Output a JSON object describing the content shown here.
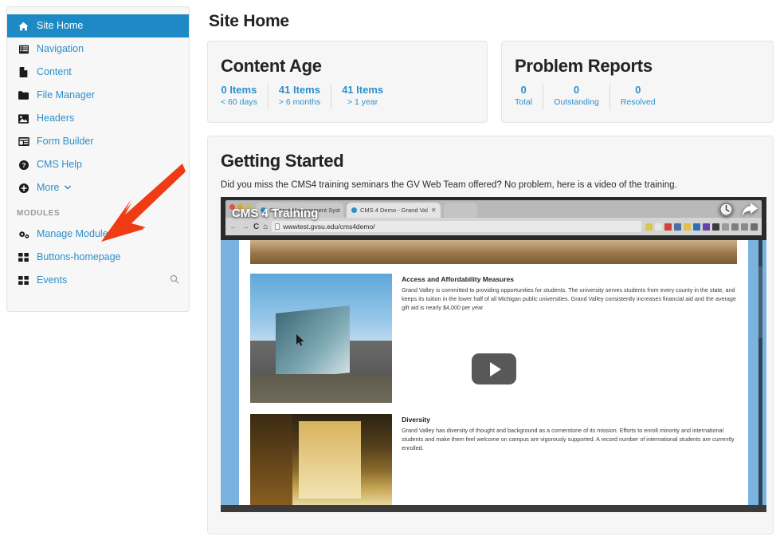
{
  "sidebar": {
    "items": [
      {
        "label": "Site Home",
        "icon": "home-icon",
        "active": true
      },
      {
        "label": "Navigation",
        "icon": "list-icon",
        "active": false
      },
      {
        "label": "Content",
        "icon": "file-icon",
        "active": false
      },
      {
        "label": "File Manager",
        "icon": "folder-icon",
        "active": false
      },
      {
        "label": "Headers",
        "icon": "image-icon",
        "active": false
      },
      {
        "label": "Form Builder",
        "icon": "form-window-icon",
        "active": false
      },
      {
        "label": "CMS Help",
        "icon": "question-circle-icon",
        "active": false
      },
      {
        "label": "More",
        "icon": "plus-circle-icon",
        "active": false,
        "caret": "chevron-down-icon"
      }
    ],
    "section_title": "MODULES",
    "modules": [
      {
        "label": "Manage Modules",
        "icon": "gears-icon"
      },
      {
        "label": "Buttons-homepage",
        "icon": "grid-icon"
      },
      {
        "label": "Events",
        "icon": "grid-icon",
        "trailing_icon": "search-icon"
      }
    ],
    "active_color": "#1d8ac5",
    "link_color": "#2d8fcb"
  },
  "annotation": {
    "type": "red-arrow",
    "color": "#f23a12",
    "points_to": "Manage Modules"
  },
  "main": {
    "page_title": "Site Home",
    "cards": [
      {
        "title": "Content Age",
        "stats": [
          {
            "value": "0 Items",
            "label": "< 60 days"
          },
          {
            "value": "41 Items",
            "label": "> 6 months"
          },
          {
            "value": "41 Items",
            "label": "> 1 year"
          }
        ]
      },
      {
        "title": "Problem Reports",
        "stats": [
          {
            "value": "0",
            "label": "Total"
          },
          {
            "value": "0",
            "label": "Outstanding"
          },
          {
            "value": "0",
            "label": "Resolved"
          }
        ]
      }
    ],
    "getting_started": {
      "title": "Getting Started",
      "description": "Did you miss the CMS4 training seminars the GV Web Team offered? No problem, here is a video of the training."
    }
  },
  "video": {
    "overlay_title": "CMS 4 Training",
    "play_button": "play-icon",
    "watch_later_icon": "clock-icon",
    "share_icon": "share-arrow-icon",
    "browser": {
      "tabs": [
        {
          "title": "Content Management Syst"
        },
        {
          "title": "CMS 4 Demo - Grand Val"
        },
        {
          "title": ""
        }
      ],
      "back": "←",
      "forward": "→",
      "reload": "C",
      "home": "⌂",
      "url": "wwwtest.gvsu.edu/cms4demo/"
    },
    "articles": [
      {
        "heading": "Access and Affordability Measures",
        "body": "Grand Valley is committed to providing opportunities for students. The university serves students from every county in the state, and keeps its tuition in the lower half of all Michigan public universities. Grand Valley consistently increases financial aid and the average gift aid is nearly $4,000 per year"
      },
      {
        "heading": "Diversity",
        "body": "Grand Valley has diversity of thought and background as a cornerstone of its mission. Efforts to enroll minority and international students and make them feel welcome on campus are vigorously supported. A record number of international students are currently enrolled."
      }
    ]
  }
}
